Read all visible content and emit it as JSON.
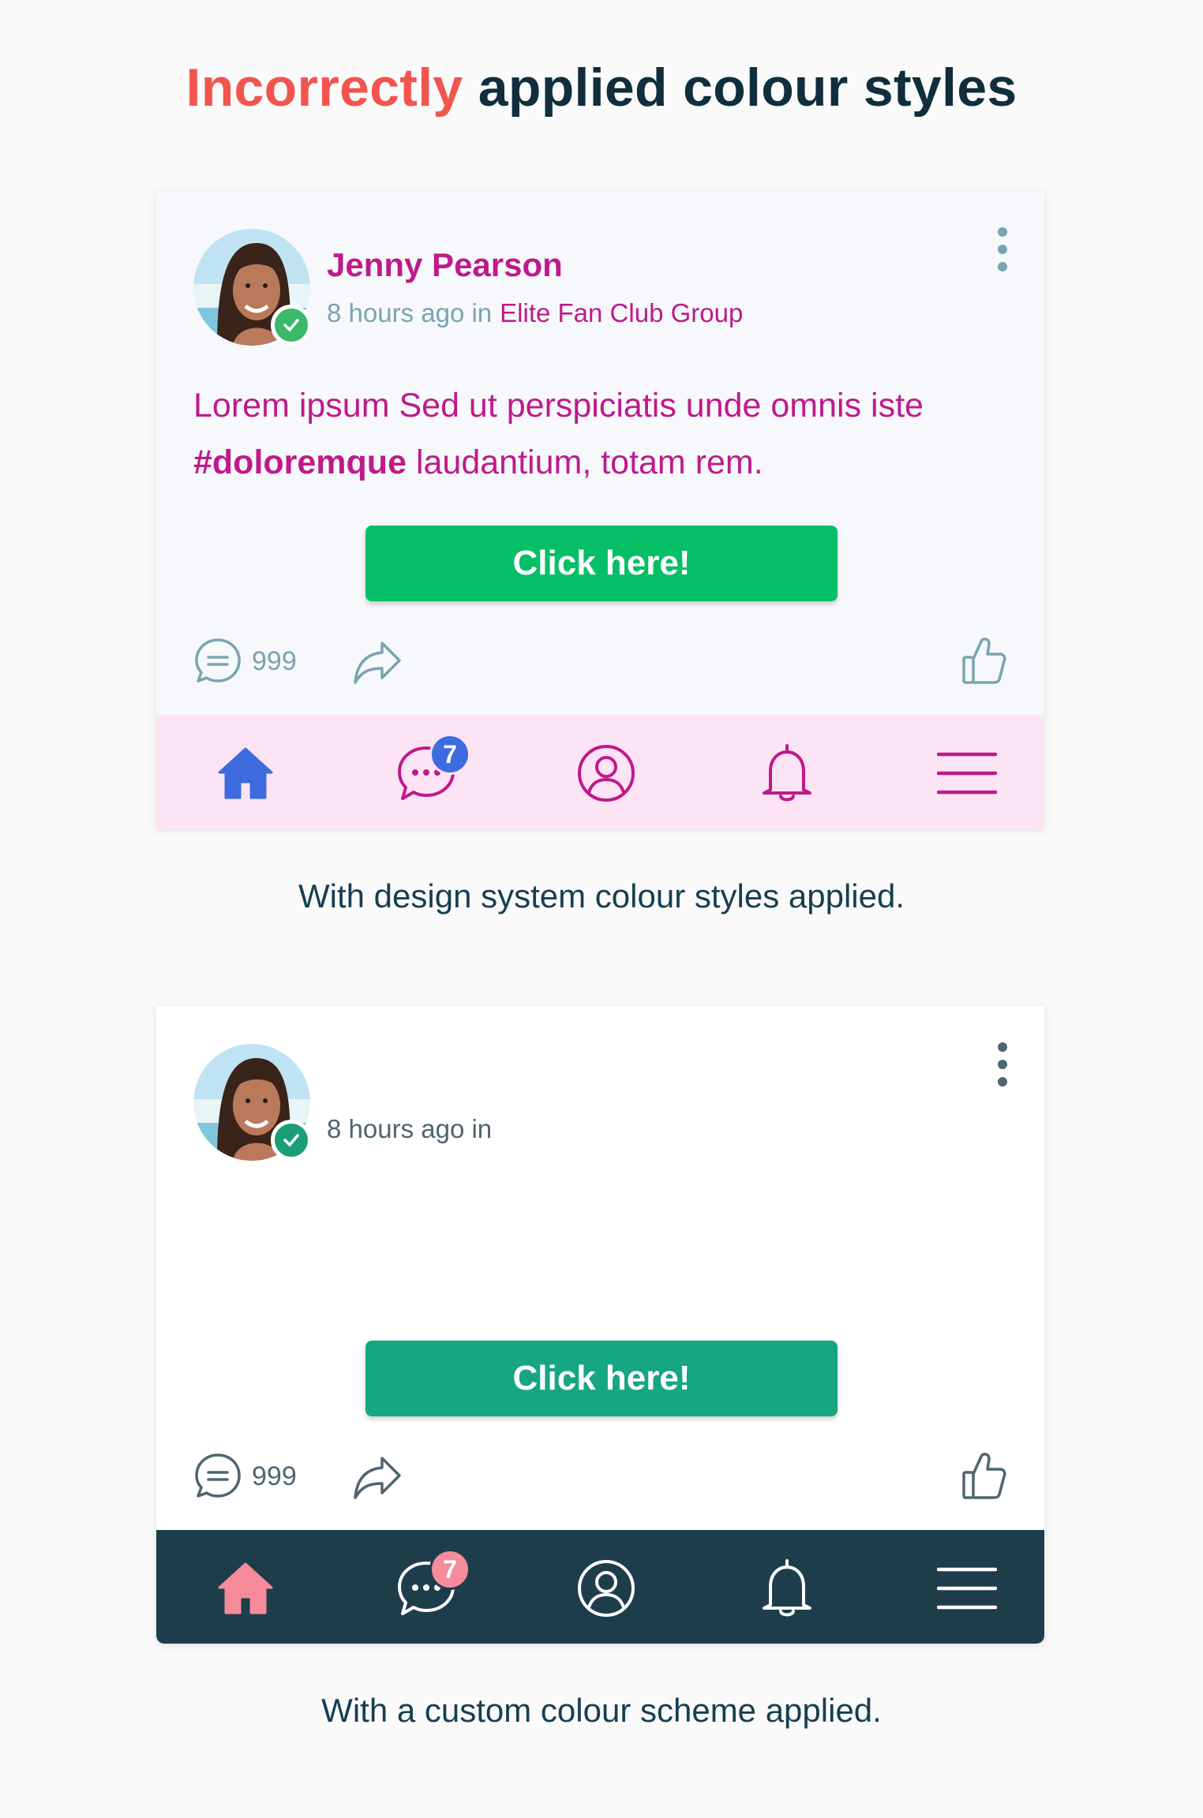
{
  "heading": {
    "highlight": "Incorrectly",
    "rest": "applied colour styles"
  },
  "colors": {
    "heading_accent": "#f2554e",
    "heading_text": "#102e3d",
    "ds_primary": "#bf1a8b",
    "ds_muted": "#7aa4b0",
    "ds_cta": "#05bf67",
    "ds_nav_bg": "#fde4f5",
    "ds_home_icon": "#3f6be0",
    "custom_cta": "#16a682",
    "custom_nav_bg": "#1e3d4b",
    "custom_accent": "#f68b9b",
    "custom_text": "#4e6670"
  },
  "card1": {
    "author": "Jenny Pearson",
    "time": "8 hours ago in",
    "group": "Elite Fan Club Group",
    "body": "Lorem ipsum Sed ut perspiciatis unde omnis iste",
    "hashtag": "#doloremque",
    "body_end": "laudantium, totam rem.",
    "cta": "Click here!",
    "comment_count": "999",
    "chat_badge": "7",
    "icons": [
      "comment-icon",
      "share-icon",
      "thumbs-up-icon",
      "home-icon",
      "chat-icon",
      "profile-icon",
      "bell-icon",
      "menu-icon",
      "more-vertical-icon",
      "verified-check-icon"
    ]
  },
  "caption1": "With design system colour styles applied.",
  "card2": {
    "time": "8 hours ago in",
    "cta": "Click here!",
    "comment_count": "999",
    "chat_badge": "7"
  },
  "caption2": "With a custom colour scheme applied."
}
